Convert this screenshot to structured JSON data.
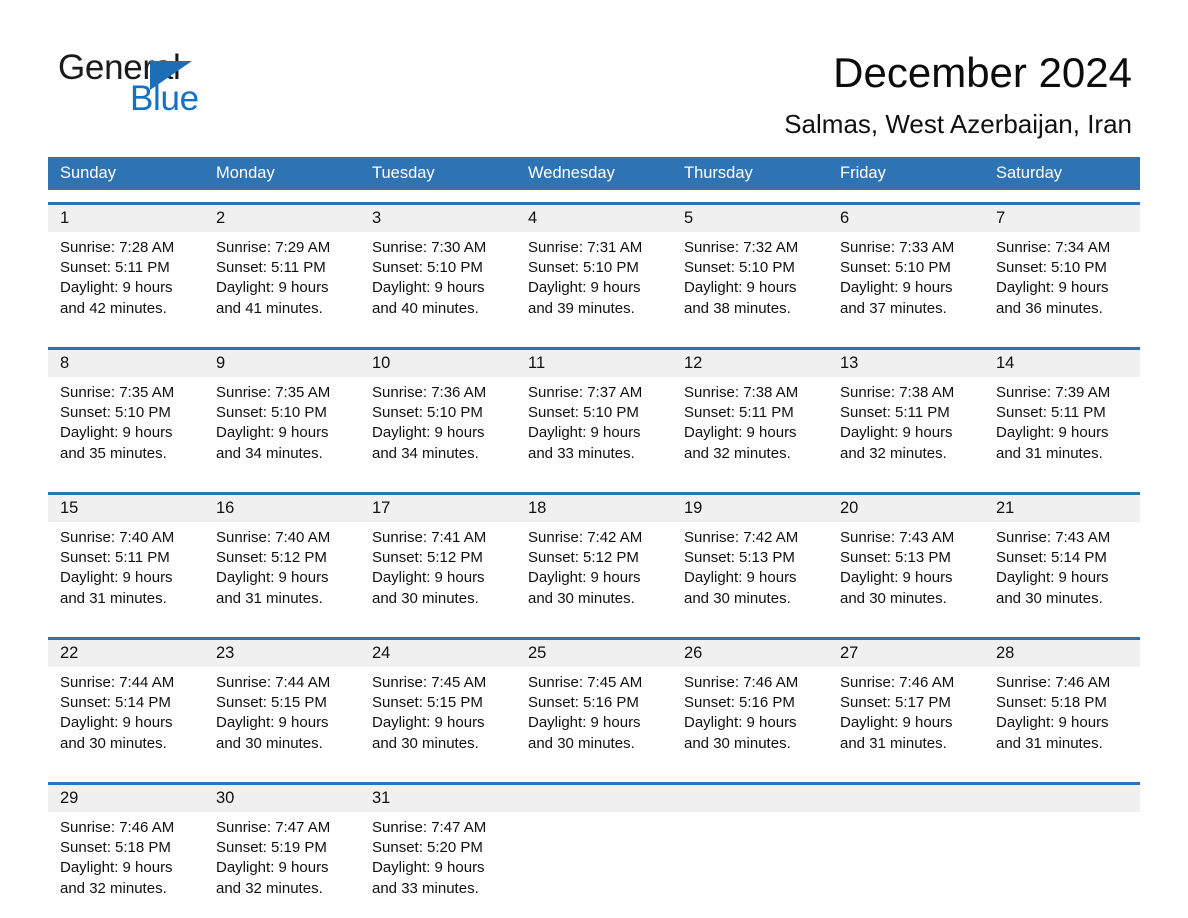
{
  "brand": {
    "logo_text_1": "General",
    "logo_text_2": "Blue",
    "accent_color": "#1d6fb5",
    "header_color": "#2e74b5"
  },
  "header": {
    "title": "December 2024",
    "location": "Salmas, West Azerbaijan, Iran"
  },
  "calendar": {
    "weekday_headers": [
      "Sunday",
      "Monday",
      "Tuesday",
      "Wednesday",
      "Thursday",
      "Friday",
      "Saturday"
    ],
    "weeks": [
      [
        {
          "day": "1",
          "sunrise": "Sunrise: 7:28 AM",
          "sunset": "Sunset: 5:11 PM",
          "daylight_1": "Daylight: 9 hours",
          "daylight_2": "and 42 minutes."
        },
        {
          "day": "2",
          "sunrise": "Sunrise: 7:29 AM",
          "sunset": "Sunset: 5:11 PM",
          "daylight_1": "Daylight: 9 hours",
          "daylight_2": "and 41 minutes."
        },
        {
          "day": "3",
          "sunrise": "Sunrise: 7:30 AM",
          "sunset": "Sunset: 5:10 PM",
          "daylight_1": "Daylight: 9 hours",
          "daylight_2": "and 40 minutes."
        },
        {
          "day": "4",
          "sunrise": "Sunrise: 7:31 AM",
          "sunset": "Sunset: 5:10 PM",
          "daylight_1": "Daylight: 9 hours",
          "daylight_2": "and 39 minutes."
        },
        {
          "day": "5",
          "sunrise": "Sunrise: 7:32 AM",
          "sunset": "Sunset: 5:10 PM",
          "daylight_1": "Daylight: 9 hours",
          "daylight_2": "and 38 minutes."
        },
        {
          "day": "6",
          "sunrise": "Sunrise: 7:33 AM",
          "sunset": "Sunset: 5:10 PM",
          "daylight_1": "Daylight: 9 hours",
          "daylight_2": "and 37 minutes."
        },
        {
          "day": "7",
          "sunrise": "Sunrise: 7:34 AM",
          "sunset": "Sunset: 5:10 PM",
          "daylight_1": "Daylight: 9 hours",
          "daylight_2": "and 36 minutes."
        }
      ],
      [
        {
          "day": "8",
          "sunrise": "Sunrise: 7:35 AM",
          "sunset": "Sunset: 5:10 PM",
          "daylight_1": "Daylight: 9 hours",
          "daylight_2": "and 35 minutes."
        },
        {
          "day": "9",
          "sunrise": "Sunrise: 7:35 AM",
          "sunset": "Sunset: 5:10 PM",
          "daylight_1": "Daylight: 9 hours",
          "daylight_2": "and 34 minutes."
        },
        {
          "day": "10",
          "sunrise": "Sunrise: 7:36 AM",
          "sunset": "Sunset: 5:10 PM",
          "daylight_1": "Daylight: 9 hours",
          "daylight_2": "and 34 minutes."
        },
        {
          "day": "11",
          "sunrise": "Sunrise: 7:37 AM",
          "sunset": "Sunset: 5:10 PM",
          "daylight_1": "Daylight: 9 hours",
          "daylight_2": "and 33 minutes."
        },
        {
          "day": "12",
          "sunrise": "Sunrise: 7:38 AM",
          "sunset": "Sunset: 5:11 PM",
          "daylight_1": "Daylight: 9 hours",
          "daylight_2": "and 32 minutes."
        },
        {
          "day": "13",
          "sunrise": "Sunrise: 7:38 AM",
          "sunset": "Sunset: 5:11 PM",
          "daylight_1": "Daylight: 9 hours",
          "daylight_2": "and 32 minutes."
        },
        {
          "day": "14",
          "sunrise": "Sunrise: 7:39 AM",
          "sunset": "Sunset: 5:11 PM",
          "daylight_1": "Daylight: 9 hours",
          "daylight_2": "and 31 minutes."
        }
      ],
      [
        {
          "day": "15",
          "sunrise": "Sunrise: 7:40 AM",
          "sunset": "Sunset: 5:11 PM",
          "daylight_1": "Daylight: 9 hours",
          "daylight_2": "and 31 minutes."
        },
        {
          "day": "16",
          "sunrise": "Sunrise: 7:40 AM",
          "sunset": "Sunset: 5:12 PM",
          "daylight_1": "Daylight: 9 hours",
          "daylight_2": "and 31 minutes."
        },
        {
          "day": "17",
          "sunrise": "Sunrise: 7:41 AM",
          "sunset": "Sunset: 5:12 PM",
          "daylight_1": "Daylight: 9 hours",
          "daylight_2": "and 30 minutes."
        },
        {
          "day": "18",
          "sunrise": "Sunrise: 7:42 AM",
          "sunset": "Sunset: 5:12 PM",
          "daylight_1": "Daylight: 9 hours",
          "daylight_2": "and 30 minutes."
        },
        {
          "day": "19",
          "sunrise": "Sunrise: 7:42 AM",
          "sunset": "Sunset: 5:13 PM",
          "daylight_1": "Daylight: 9 hours",
          "daylight_2": "and 30 minutes."
        },
        {
          "day": "20",
          "sunrise": "Sunrise: 7:43 AM",
          "sunset": "Sunset: 5:13 PM",
          "daylight_1": "Daylight: 9 hours",
          "daylight_2": "and 30 minutes."
        },
        {
          "day": "21",
          "sunrise": "Sunrise: 7:43 AM",
          "sunset": "Sunset: 5:14 PM",
          "daylight_1": "Daylight: 9 hours",
          "daylight_2": "and 30 minutes."
        }
      ],
      [
        {
          "day": "22",
          "sunrise": "Sunrise: 7:44 AM",
          "sunset": "Sunset: 5:14 PM",
          "daylight_1": "Daylight: 9 hours",
          "daylight_2": "and 30 minutes."
        },
        {
          "day": "23",
          "sunrise": "Sunrise: 7:44 AM",
          "sunset": "Sunset: 5:15 PM",
          "daylight_1": "Daylight: 9 hours",
          "daylight_2": "and 30 minutes."
        },
        {
          "day": "24",
          "sunrise": "Sunrise: 7:45 AM",
          "sunset": "Sunset: 5:15 PM",
          "daylight_1": "Daylight: 9 hours",
          "daylight_2": "and 30 minutes."
        },
        {
          "day": "25",
          "sunrise": "Sunrise: 7:45 AM",
          "sunset": "Sunset: 5:16 PM",
          "daylight_1": "Daylight: 9 hours",
          "daylight_2": "and 30 minutes."
        },
        {
          "day": "26",
          "sunrise": "Sunrise: 7:46 AM",
          "sunset": "Sunset: 5:16 PM",
          "daylight_1": "Daylight: 9 hours",
          "daylight_2": "and 30 minutes."
        },
        {
          "day": "27",
          "sunrise": "Sunrise: 7:46 AM",
          "sunset": "Sunset: 5:17 PM",
          "daylight_1": "Daylight: 9 hours",
          "daylight_2": "and 31 minutes."
        },
        {
          "day": "28",
          "sunrise": "Sunrise: 7:46 AM",
          "sunset": "Sunset: 5:18 PM",
          "daylight_1": "Daylight: 9 hours",
          "daylight_2": "and 31 minutes."
        }
      ],
      [
        {
          "day": "29",
          "sunrise": "Sunrise: 7:46 AM",
          "sunset": "Sunset: 5:18 PM",
          "daylight_1": "Daylight: 9 hours",
          "daylight_2": "and 32 minutes."
        },
        {
          "day": "30",
          "sunrise": "Sunrise: 7:47 AM",
          "sunset": "Sunset: 5:19 PM",
          "daylight_1": "Daylight: 9 hours",
          "daylight_2": "and 32 minutes."
        },
        {
          "day": "31",
          "sunrise": "Sunrise: 7:47 AM",
          "sunset": "Sunset: 5:20 PM",
          "daylight_1": "Daylight: 9 hours",
          "daylight_2": "and 33 minutes."
        },
        {
          "day": "",
          "sunrise": "",
          "sunset": "",
          "daylight_1": "",
          "daylight_2": ""
        },
        {
          "day": "",
          "sunrise": "",
          "sunset": "",
          "daylight_1": "",
          "daylight_2": ""
        },
        {
          "day": "",
          "sunrise": "",
          "sunset": "",
          "daylight_1": "",
          "daylight_2": ""
        },
        {
          "day": "",
          "sunrise": "",
          "sunset": "",
          "daylight_1": "",
          "daylight_2": ""
        }
      ]
    ]
  }
}
